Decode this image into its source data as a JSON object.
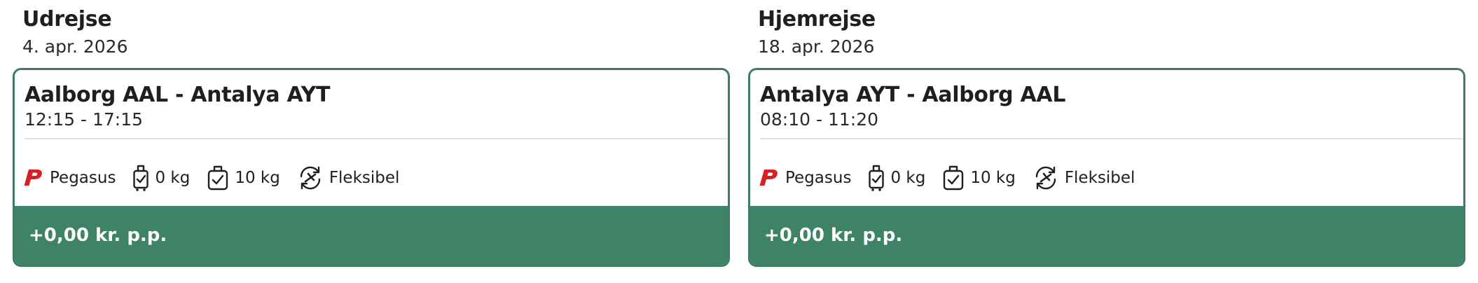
{
  "outbound": {
    "heading": "Udrejse",
    "date": "4. apr. 2026",
    "route": "Aalborg AAL - Antalya AYT",
    "times": "12:15 - 17:15",
    "airline": "Pegasus",
    "carry_on": "0 kg",
    "checked": "10 kg",
    "fare": "Fleksibel",
    "price": "+0,00 kr. p.p.",
    "icons": {
      "airline": "pegasus-logo-icon",
      "carry_on": "carry-on-bag-check-icon",
      "checked": "checked-bag-check-icon",
      "fare": "flexible-ticket-icon"
    }
  },
  "return": {
    "heading": "Hjemrejse",
    "date": "18. apr. 2026",
    "route": "Antalya AYT - Aalborg AAL",
    "times": "08:10 - 11:20",
    "airline": "Pegasus",
    "carry_on": "0 kg",
    "checked": "10 kg",
    "fare": "Fleksibel",
    "price": "+0,00 kr. p.p.",
    "icons": {
      "airline": "pegasus-logo-icon",
      "carry_on": "carry-on-bag-check-icon",
      "checked": "checked-bag-check-icon",
      "fare": "flexible-ticket-icon"
    }
  },
  "colors": {
    "card_border": "#3e7d63",
    "price_bar": "#3e8367",
    "airline_logo": "#d71f26",
    "divider": "#e6e1d7"
  }
}
